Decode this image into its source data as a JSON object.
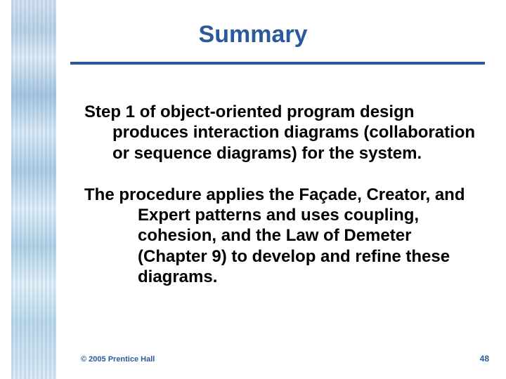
{
  "title": "Summary",
  "para1": "Step 1 of object-oriented program design produces interaction diagrams (collaboration or sequence diagrams) for the system.",
  "para2": "The procedure applies the Façade, Creator, and Expert patterns and uses coupling, cohesion, and the Law of Demeter (Chapter 9) to develop and refine these diagrams.",
  "copyright": "© 2005 Prentice Hall",
  "page_number": "48"
}
